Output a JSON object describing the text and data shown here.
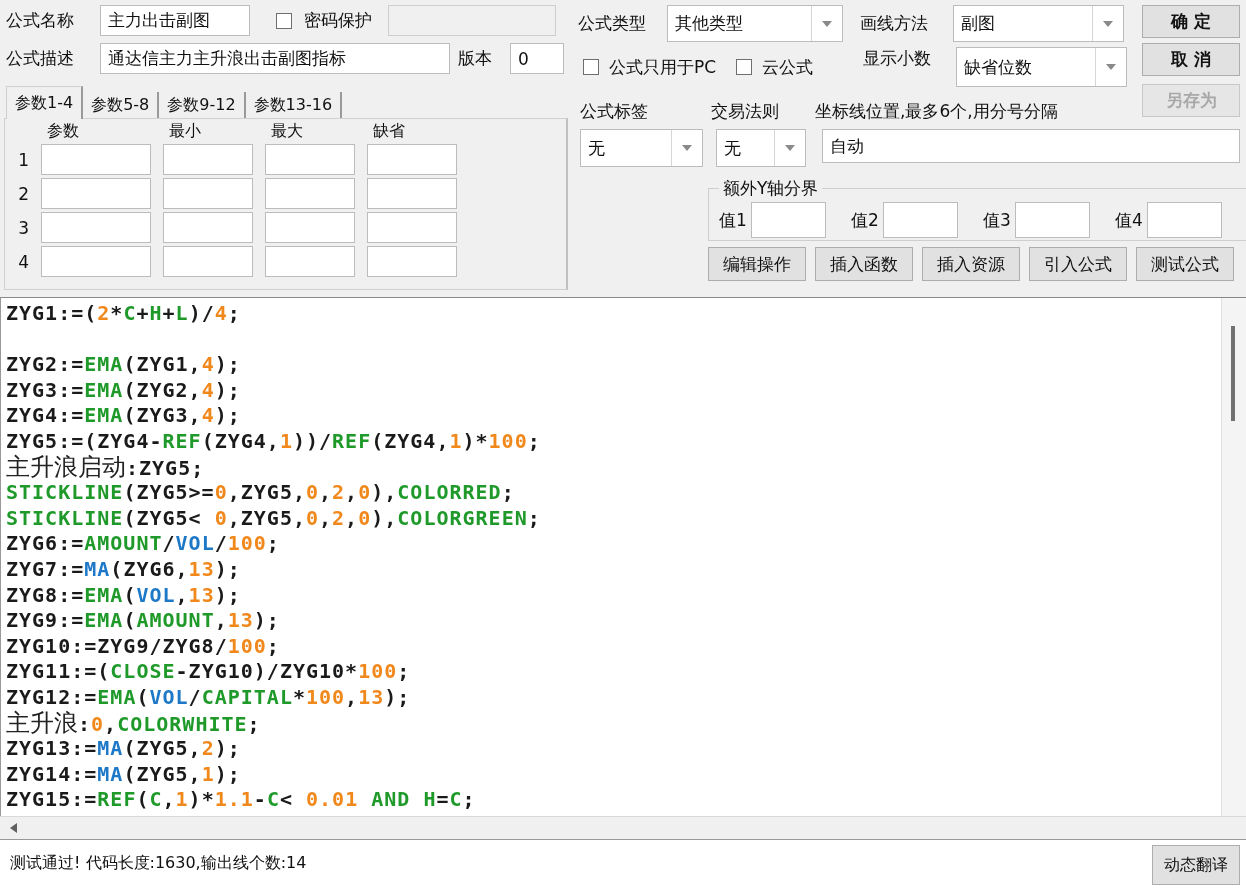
{
  "formula_name": {
    "label": "公式名称",
    "value": "主力出击副图"
  },
  "password": {
    "label": "密码保护",
    "checked": false
  },
  "description": {
    "label": "公式描述",
    "value": "通达信主力主升浪出击副图指标"
  },
  "version": {
    "label": "版本",
    "value": "0"
  },
  "param_tabs": [
    {
      "label": "参数1-4",
      "selected": true
    },
    {
      "label": "参数5-8",
      "selected": false
    },
    {
      "label": "参数9-12",
      "selected": false
    },
    {
      "label": "参数13-16",
      "selected": false
    }
  ],
  "param_table": {
    "columns": [
      "参数",
      "最小",
      "最大",
      "缺省"
    ],
    "rows": [
      "1",
      "2",
      "3",
      "4"
    ]
  },
  "formula_type": {
    "label": "公式类型",
    "value": "其他类型"
  },
  "draw_method": {
    "label": "画线方法",
    "value": "副图"
  },
  "options": [
    {
      "label": "公式只用于PC",
      "checked": false
    },
    {
      "label": "云公式",
      "checked": false
    }
  ],
  "decimals": {
    "label": "显示小数",
    "value": "缺省位数"
  },
  "side_buttons": [
    {
      "label": "确 定",
      "disabled": false
    },
    {
      "label": "取 消",
      "disabled": false
    },
    {
      "label": "另存为",
      "disabled": true
    }
  ],
  "tag": {
    "label": "公式标签",
    "value": "无"
  },
  "trade_rule": {
    "label": "交易法则",
    "value": "无"
  },
  "axis_lines": {
    "label": "坐标线位置,最多6个,用分号分隔",
    "value": "自动"
  },
  "y_bounds": {
    "title": "额外Y轴分界",
    "fields": [
      "值1",
      "值2",
      "值3",
      "值4"
    ]
  },
  "tool_buttons": [
    "编辑操作",
    "插入函数",
    "插入资源",
    "引入公式",
    "测试公式"
  ],
  "code_lines": [
    {
      "kind": "code",
      "tokens": [
        {
          "text": "ZYG1:=(",
          "kind": "plain"
        },
        {
          "text": "2",
          "kind": "num"
        },
        {
          "text": "*",
          "kind": "plain"
        },
        {
          "text": "C",
          "kind": "fn"
        },
        {
          "text": "+",
          "kind": "plain"
        },
        {
          "text": "H",
          "kind": "fn"
        },
        {
          "text": "+",
          "kind": "plain"
        },
        {
          "text": "L",
          "kind": "fn"
        },
        {
          "text": ")/",
          "kind": "plain"
        },
        {
          "text": "4",
          "kind": "num"
        },
        {
          "text": ";",
          "kind": "plain"
        }
      ]
    },
    {
      "kind": "blank"
    },
    {
      "kind": "code",
      "tokens": [
        {
          "text": "ZYG2:=",
          "kind": "plain"
        },
        {
          "text": "EMA",
          "kind": "fn"
        },
        {
          "text": "(ZYG1,",
          "kind": "plain"
        },
        {
          "text": "4",
          "kind": "num"
        },
        {
          "text": ");",
          "kind": "plain"
        }
      ]
    },
    {
      "kind": "code",
      "tokens": [
        {
          "text": "ZYG3:=",
          "kind": "plain"
        },
        {
          "text": "EMA",
          "kind": "fn"
        },
        {
          "text": "(ZYG2,",
          "kind": "plain"
        },
        {
          "text": "4",
          "kind": "num"
        },
        {
          "text": ");",
          "kind": "plain"
        }
      ]
    },
    {
      "kind": "code",
      "tokens": [
        {
          "text": "ZYG4:=",
          "kind": "plain"
        },
        {
          "text": "EMA",
          "kind": "fn"
        },
        {
          "text": "(ZYG3,",
          "kind": "plain"
        },
        {
          "text": "4",
          "kind": "num"
        },
        {
          "text": ");",
          "kind": "plain"
        }
      ]
    },
    {
      "kind": "code",
      "tokens": [
        {
          "text": "ZYG5:=(ZYG4-",
          "kind": "plain"
        },
        {
          "text": "REF",
          "kind": "fn"
        },
        {
          "text": "(ZYG4,",
          "kind": "plain"
        },
        {
          "text": "1",
          "kind": "num"
        },
        {
          "text": "))/",
          "kind": "plain"
        },
        {
          "text": "REF",
          "kind": "fn"
        },
        {
          "text": "(ZYG4,",
          "kind": "plain"
        },
        {
          "text": "1",
          "kind": "num"
        },
        {
          "text": ")*",
          "kind": "plain"
        },
        {
          "text": "100",
          "kind": "num"
        },
        {
          "text": ";",
          "kind": "plain"
        }
      ]
    },
    {
      "kind": "code",
      "tokens": [
        {
          "text": "主升浪启动",
          "kind": "label"
        },
        {
          "text": ":ZYG5;",
          "kind": "plain"
        }
      ]
    },
    {
      "kind": "code",
      "tokens": [
        {
          "text": "STICKLINE",
          "kind": "fn"
        },
        {
          "text": "(ZYG5>=",
          "kind": "plain"
        },
        {
          "text": "0",
          "kind": "num"
        },
        {
          "text": ",ZYG5,",
          "kind": "plain"
        },
        {
          "text": "0",
          "kind": "num"
        },
        {
          "text": ",",
          "kind": "plain"
        },
        {
          "text": "2",
          "kind": "num"
        },
        {
          "text": ",",
          "kind": "plain"
        },
        {
          "text": "0",
          "kind": "num"
        },
        {
          "text": "),",
          "kind": "plain"
        },
        {
          "text": "COLORRED",
          "kind": "fn"
        },
        {
          "text": ";",
          "kind": "plain"
        }
      ]
    },
    {
      "kind": "code",
      "tokens": [
        {
          "text": "STICKLINE",
          "kind": "fn"
        },
        {
          "text": "(ZYG5< ",
          "kind": "plain"
        },
        {
          "text": "0",
          "kind": "num"
        },
        {
          "text": ",ZYG5,",
          "kind": "plain"
        },
        {
          "text": "0",
          "kind": "num"
        },
        {
          "text": ",",
          "kind": "plain"
        },
        {
          "text": "2",
          "kind": "num"
        },
        {
          "text": ",",
          "kind": "plain"
        },
        {
          "text": "0",
          "kind": "num"
        },
        {
          "text": "),",
          "kind": "plain"
        },
        {
          "text": "COLORGREEN",
          "kind": "fn"
        },
        {
          "text": ";",
          "kind": "plain"
        }
      ]
    },
    {
      "kind": "code",
      "tokens": [
        {
          "text": "ZYG6:=",
          "kind": "plain"
        },
        {
          "text": "AMOUNT",
          "kind": "fn"
        },
        {
          "text": "/",
          "kind": "plain"
        },
        {
          "text": "VOL",
          "kind": "var"
        },
        {
          "text": "/",
          "kind": "plain"
        },
        {
          "text": "100",
          "kind": "num"
        },
        {
          "text": ";",
          "kind": "plain"
        }
      ]
    },
    {
      "kind": "code",
      "tokens": [
        {
          "text": "ZYG7:=",
          "kind": "plain"
        },
        {
          "text": "MA",
          "kind": "var"
        },
        {
          "text": "(ZYG6,",
          "kind": "plain"
        },
        {
          "text": "13",
          "kind": "num"
        },
        {
          "text": ");",
          "kind": "plain"
        }
      ]
    },
    {
      "kind": "code",
      "tokens": [
        {
          "text": "ZYG8:=",
          "kind": "plain"
        },
        {
          "text": "EMA",
          "kind": "fn"
        },
        {
          "text": "(",
          "kind": "plain"
        },
        {
          "text": "VOL",
          "kind": "var"
        },
        {
          "text": ",",
          "kind": "plain"
        },
        {
          "text": "13",
          "kind": "num"
        },
        {
          "text": ");",
          "kind": "plain"
        }
      ]
    },
    {
      "kind": "code",
      "tokens": [
        {
          "text": "ZYG9:=",
          "kind": "plain"
        },
        {
          "text": "EMA",
          "kind": "fn"
        },
        {
          "text": "(",
          "kind": "plain"
        },
        {
          "text": "AMOUNT",
          "kind": "fn"
        },
        {
          "text": ",",
          "kind": "plain"
        },
        {
          "text": "13",
          "kind": "num"
        },
        {
          "text": ");",
          "kind": "plain"
        }
      ]
    },
    {
      "kind": "code",
      "tokens": [
        {
          "text": "ZYG10:=ZYG9/ZYG8/",
          "kind": "plain"
        },
        {
          "text": "100",
          "kind": "num"
        },
        {
          "text": ";",
          "kind": "plain"
        }
      ]
    },
    {
      "kind": "code",
      "tokens": [
        {
          "text": "ZYG11:=(",
          "kind": "plain"
        },
        {
          "text": "CLOSE",
          "kind": "fn"
        },
        {
          "text": "-ZYG10)/ZYG10*",
          "kind": "plain"
        },
        {
          "text": "100",
          "kind": "num"
        },
        {
          "text": ";",
          "kind": "plain"
        }
      ]
    },
    {
      "kind": "code",
      "tokens": [
        {
          "text": "ZYG12:=",
          "kind": "plain"
        },
        {
          "text": "EMA",
          "kind": "fn"
        },
        {
          "text": "(",
          "kind": "plain"
        },
        {
          "text": "VOL",
          "kind": "var"
        },
        {
          "text": "/",
          "kind": "plain"
        },
        {
          "text": "CAPITAL",
          "kind": "fn"
        },
        {
          "text": "*",
          "kind": "plain"
        },
        {
          "text": "100",
          "kind": "num"
        },
        {
          "text": ",",
          "kind": "plain"
        },
        {
          "text": "13",
          "kind": "num"
        },
        {
          "text": ");",
          "kind": "plain"
        }
      ]
    },
    {
      "kind": "code",
      "tokens": [
        {
          "text": "主升浪",
          "kind": "label"
        },
        {
          "text": ":",
          "kind": "plain"
        },
        {
          "text": "0",
          "kind": "num"
        },
        {
          "text": ",",
          "kind": "plain"
        },
        {
          "text": "COLORWHITE",
          "kind": "fn"
        },
        {
          "text": ";",
          "kind": "plain"
        }
      ]
    },
    {
      "kind": "code",
      "tokens": [
        {
          "text": "ZYG13:=",
          "kind": "plain"
        },
        {
          "text": "MA",
          "kind": "var"
        },
        {
          "text": "(ZYG5,",
          "kind": "plain"
        },
        {
          "text": "2",
          "kind": "num"
        },
        {
          "text": ");",
          "kind": "plain"
        }
      ]
    },
    {
      "kind": "code",
      "tokens": [
        {
          "text": "ZYG14:=",
          "kind": "plain"
        },
        {
          "text": "MA",
          "kind": "var"
        },
        {
          "text": "(ZYG5,",
          "kind": "plain"
        },
        {
          "text": "1",
          "kind": "num"
        },
        {
          "text": ");",
          "kind": "plain"
        }
      ]
    },
    {
      "kind": "code",
      "tokens": [
        {
          "text": "ZYG15:=",
          "kind": "plain"
        },
        {
          "text": "REF",
          "kind": "fn"
        },
        {
          "text": "(",
          "kind": "plain"
        },
        {
          "text": "C",
          "kind": "fn"
        },
        {
          "text": ",",
          "kind": "plain"
        },
        {
          "text": "1",
          "kind": "num"
        },
        {
          "text": ")*",
          "kind": "plain"
        },
        {
          "text": "1.1",
          "kind": "num"
        },
        {
          "text": "-",
          "kind": "plain"
        },
        {
          "text": "C",
          "kind": "fn"
        },
        {
          "text": "< ",
          "kind": "plain"
        },
        {
          "text": "0.01 ",
          "kind": "num"
        },
        {
          "text": "AND ",
          "kind": "fn"
        },
        {
          "text": "H",
          "kind": "fn"
        },
        {
          "text": "=",
          "kind": "plain"
        },
        {
          "text": "C",
          "kind": "fn"
        },
        {
          "text": ";",
          "kind": "plain"
        }
      ]
    }
  ],
  "status": {
    "message": "测试通过! 代码长度:1630,输出线个数:14",
    "button": "动态翻译"
  }
}
